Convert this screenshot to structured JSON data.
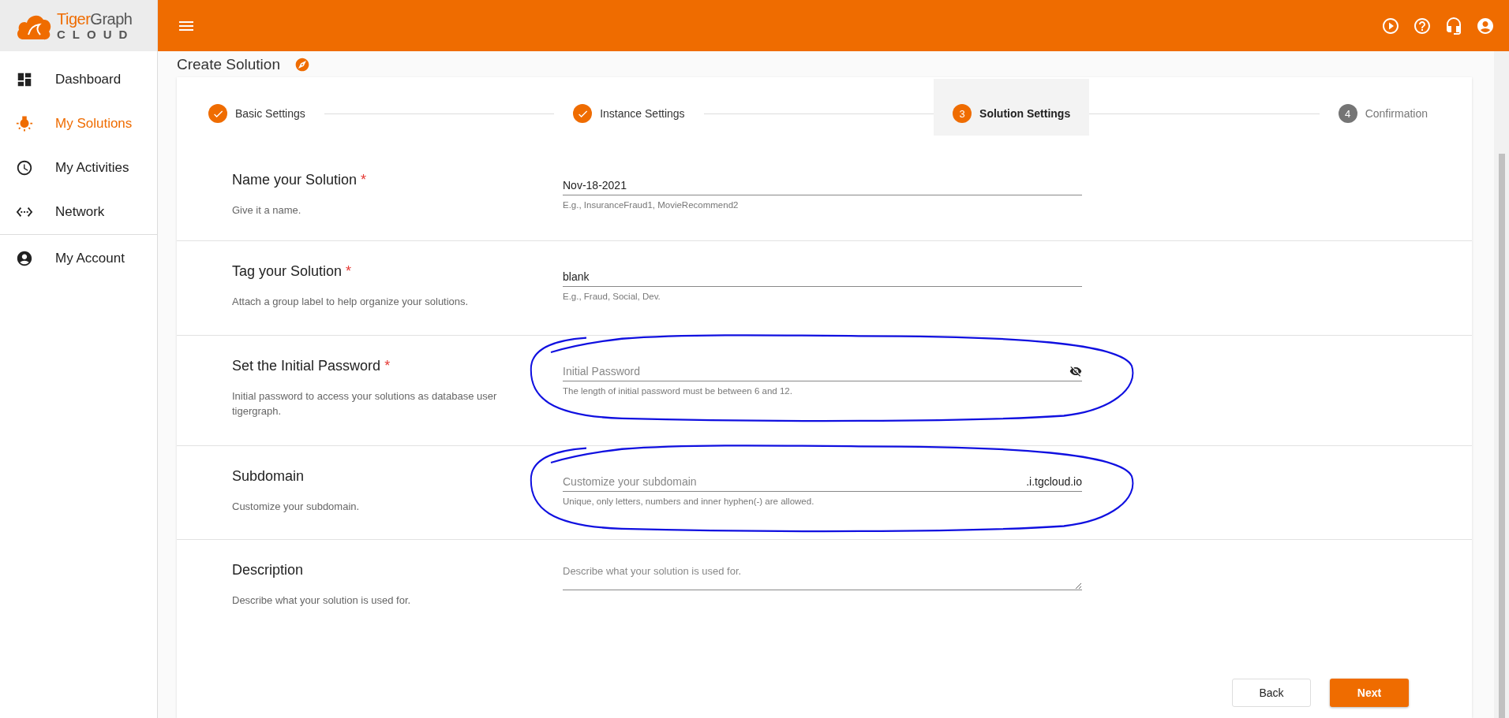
{
  "brand": {
    "part_1": "Tiger",
    "part_2": "Graph",
    "sub": "CLOUD"
  },
  "sidebar": {
    "groups": [
      [
        {
          "label": "Dashboard",
          "selected": false
        },
        {
          "label": "My Solutions",
          "selected": true
        },
        {
          "label": "My Activities",
          "selected": false
        },
        {
          "label": "Network",
          "selected": false
        }
      ],
      [
        {
          "label": "My Account",
          "selected": false
        }
      ]
    ]
  },
  "page_title": "Create Solution",
  "stepper": [
    {
      "label": "Basic Settings",
      "kind": "done",
      "selected": false
    },
    {
      "label": "Instance Settings",
      "kind": "done",
      "selected": false
    },
    {
      "label": "Solution Settings",
      "kind": "active",
      "number": "3",
      "selected": true
    },
    {
      "label": "Confirmation",
      "kind": "pending",
      "number": "4",
      "selected": false
    }
  ],
  "sections": [
    {
      "title": "Name your Solution",
      "required_mark": "*",
      "description": "Give it a name.",
      "field": {
        "kind": "text",
        "value": "Nov-18-2021",
        "helper": "E.g., InsuranceFraud1, MovieRecommend2"
      },
      "circled": false
    },
    {
      "title": "Tag your Solution",
      "required_mark": "*",
      "description": "Attach a group label to help organize your solutions.",
      "field": {
        "kind": "text",
        "value": "blank",
        "helper": "E.g., Fraud, Social, Dev."
      },
      "circled": false
    },
    {
      "title": "Set the Initial Password",
      "required_mark": "*",
      "description": "Initial password to access your solutions as database user tigergraph.",
      "field": {
        "kind": "password",
        "placeholder": "Initial Password",
        "helper": "The length of initial password must be between 6 and 12."
      },
      "circled": true
    },
    {
      "title": "Subdomain",
      "description": "Customize your subdomain.",
      "field": {
        "kind": "suffix",
        "placeholder": "Customize your subdomain",
        "suffix": ".i.tgcloud.io",
        "helper": "Unique, only letters, numbers and inner hyphen(-) are allowed."
      },
      "circled": true
    },
    {
      "title": "Description",
      "description": "Describe what your solution is used for.",
      "field": {
        "kind": "textarea",
        "placeholder": "Describe what your solution is used for."
      },
      "circled": false
    }
  ],
  "buttons": [
    {
      "label": "Back",
      "kind": "secondary"
    },
    {
      "label": "Next",
      "kind": "primary"
    }
  ]
}
